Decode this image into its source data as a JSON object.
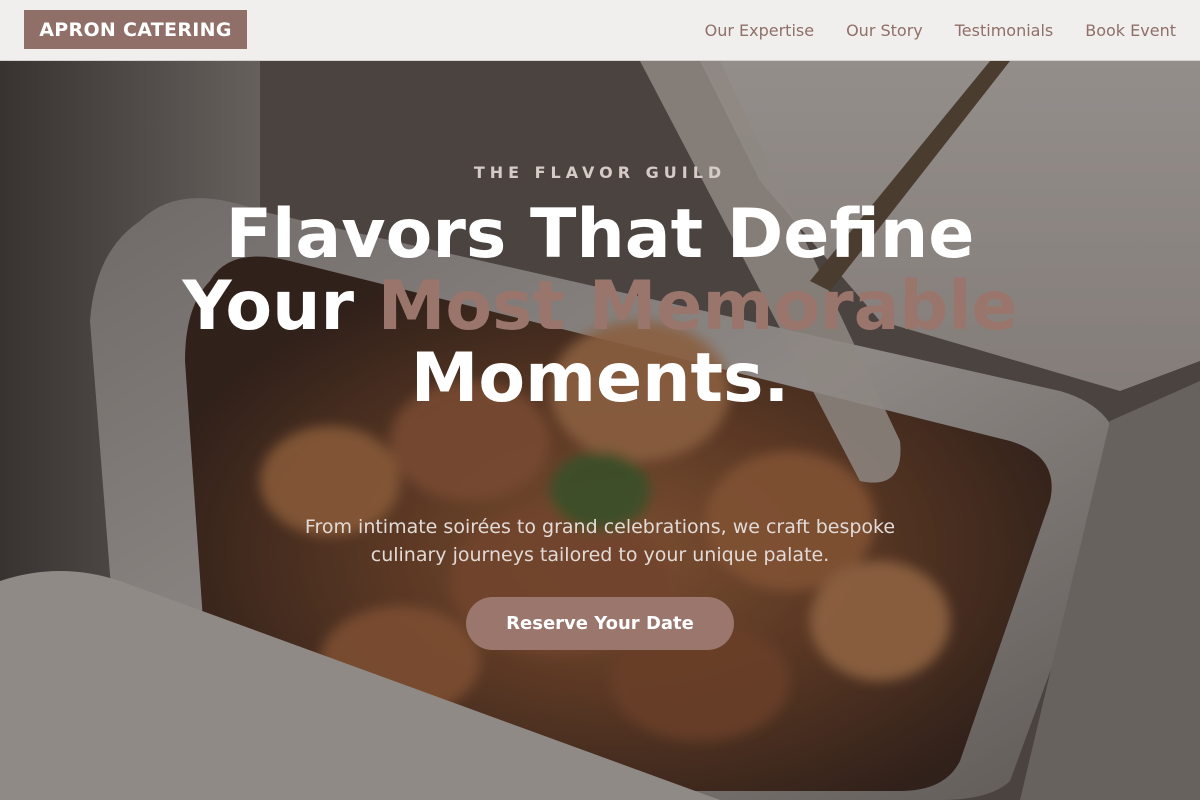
{
  "brand": {
    "logo_text": "APRON CATERING"
  },
  "nav": {
    "items": [
      {
        "label": "Our Expertise"
      },
      {
        "label": "Our Story"
      },
      {
        "label": "Testimonials"
      },
      {
        "label": "Book Event"
      }
    ]
  },
  "hero": {
    "eyebrow": "THE FLAVOR GUILD",
    "headline_part1": "Flavors That Define Your ",
    "headline_accent": "Most Memorable",
    "headline_part2": " Moments.",
    "subtext": "From intimate soirées to grand celebrations, we craft bespoke culinary journeys tailored to your unique palate.",
    "cta_label": "Reserve Your Date",
    "background_image": "catering-food-tray-photo"
  },
  "colors": {
    "brand": "#8f6f67",
    "accent_text": "#9a756b",
    "header_bg": "#f1efee",
    "button_bg": "#9a766d"
  }
}
